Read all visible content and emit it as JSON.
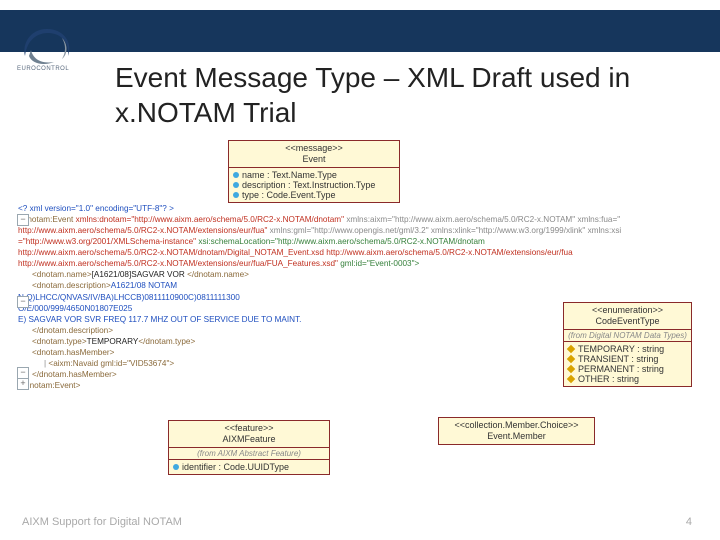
{
  "header": {
    "org": "EUROCONTROL"
  },
  "title": "Event Message Type – XML Draft used in x.NOTAM Trial",
  "uml": {
    "message": {
      "stereo": "<<message>>",
      "name": "Event",
      "attrs": [
        "name : Text.Name.Type",
        "description : Text.Instruction.Type",
        "type : Code.Event.Type"
      ]
    },
    "enum": {
      "stereo": "<<enumeration>>",
      "name": "CodeEventType",
      "from": "(from Digital NOTAM Data Types)",
      "items": [
        "TEMPORARY : string",
        "TRANSIENT : string",
        "PERMANENT : string",
        "OTHER : string"
      ]
    },
    "collection": {
      "stereo": "<<collection.Member.Choice>>",
      "name": "Event.Member"
    },
    "feature": {
      "stereo": "<<feature>>",
      "name": "AIXMFeature",
      "from": "(from AIXM Abstract Feature)",
      "attr": "identifier : Code.UUIDType"
    }
  },
  "xml": {
    "decl": "<? xml version=\"1.0\" encoding=\"UTF-8\"? >",
    "openTag": "<dnotam:Event",
    "ns_dnotam": "xmlns:dnotam=\"http://www.aixm.aero/schema/5.0/RC2-x.NOTAM/dnotam\"",
    "ns_aixm": "xmlns:aixm=\"http://www.aixm.aero/schema/5.0/RC2-x.NOTAM\"",
    "ns_fua": "xmlns:fua=\"",
    "ns_fua_url": "http://www.aixm.aero/schema/5.0/RC2-x.NOTAM/extensions/eur/fua\"",
    "ns_gml": "xmlns:gml=\"http://www.opengis.net/gml/3.2\"",
    "ns_xlink": "xmlns:xlink=\"http://www.w3.org/1999/xlink\"",
    "ns_xsi": "xmlns:xsi",
    "ns_xsi_url": "=\"http://www.w3.org/2001/XMLSchema-instance\"",
    "schemaLoc": "xsi:schemaLocation=\"http://www.aixm.aero/schema/5.0/RC2-x.NOTAM/dnotam",
    "schemaLoc2": "http://www.aixm.aero/schema/5.0/RC2-x.NOTAM/dnotam/Digital_NOTAM_Event.xsd http://www.aixm.aero/schema/5.0/RC2-x.NOTAM/extensions/eur/fua",
    "schemaLoc3": "http://www.aixm.aero/schema/5.0/RC2-x.NOTAM/extensions/eur/fua/FUA_Features.xsd\"",
    "gmlid": "gml:id=\"Event-0003\">",
    "name_open": "<dnotam.name>",
    "name_text": "[A1621/08]SAGVAR VOR ",
    "name_close": "</dnotam.name>",
    "desc_open": "<dnotam.description>",
    "desc_l1": "A1621/08 NOTAM",
    "desc_l2": "N Q)LHCC/QNVAS/IV/BA)LHCCB)0811110900C)0811111300",
    "desc_l3": "O/E/000/999/4650N01807E025",
    "desc_l4": "E) SAGVAR VOR SVR FREQ 117.7 MHZ OUT OF SERVICE DUE TO MAINT.",
    "desc_close": "</dnotam.description>",
    "type_open": "<dnotam.type>",
    "type_text": "TEMPORARY",
    "type_close": "</dnotam.type>",
    "hasMember_open": "<dnotam.hasMember>",
    "navaid": "<aixm:Navaid gml:id=\"VID53674\">",
    "hasMember_close": "</dnotam.hasMember>",
    "event_close": "</dnotam:Event>"
  },
  "footer": {
    "left": "AIXM Support for Digital NOTAM",
    "page": "4"
  }
}
